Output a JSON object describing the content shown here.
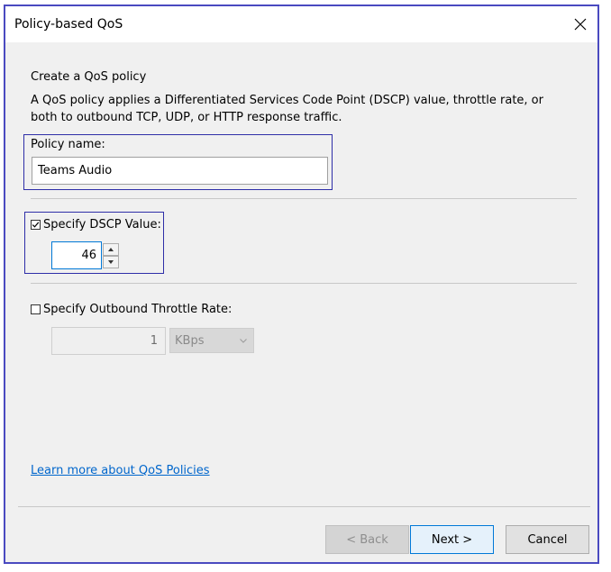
{
  "window": {
    "title": "Policy-based QoS"
  },
  "heading": "Create a QoS policy",
  "description": "A QoS policy applies a Differentiated Services Code Point (DSCP) value, throttle rate, or both to outbound TCP, UDP, or HTTP response traffic.",
  "policy_name": {
    "label": "Policy name:",
    "value": "Teams Audio"
  },
  "dscp": {
    "label": "Specify DSCP Value:",
    "checked": true,
    "value": "46"
  },
  "throttle": {
    "label": "Specify Outbound Throttle Rate:",
    "checked": false,
    "value": "1",
    "unit": "KBps"
  },
  "link": "Learn more about QoS Policies",
  "buttons": {
    "back": "< Back",
    "next": "Next >",
    "cancel": "Cancel"
  },
  "colors": {
    "highlight": "#2e2ea8",
    "link": "#0066cc",
    "primary_border": "#0078d7"
  },
  "icons": [
    "close-icon",
    "checkmark-icon",
    "spin-up-icon",
    "spin-down-icon",
    "chevron-down-icon"
  ]
}
